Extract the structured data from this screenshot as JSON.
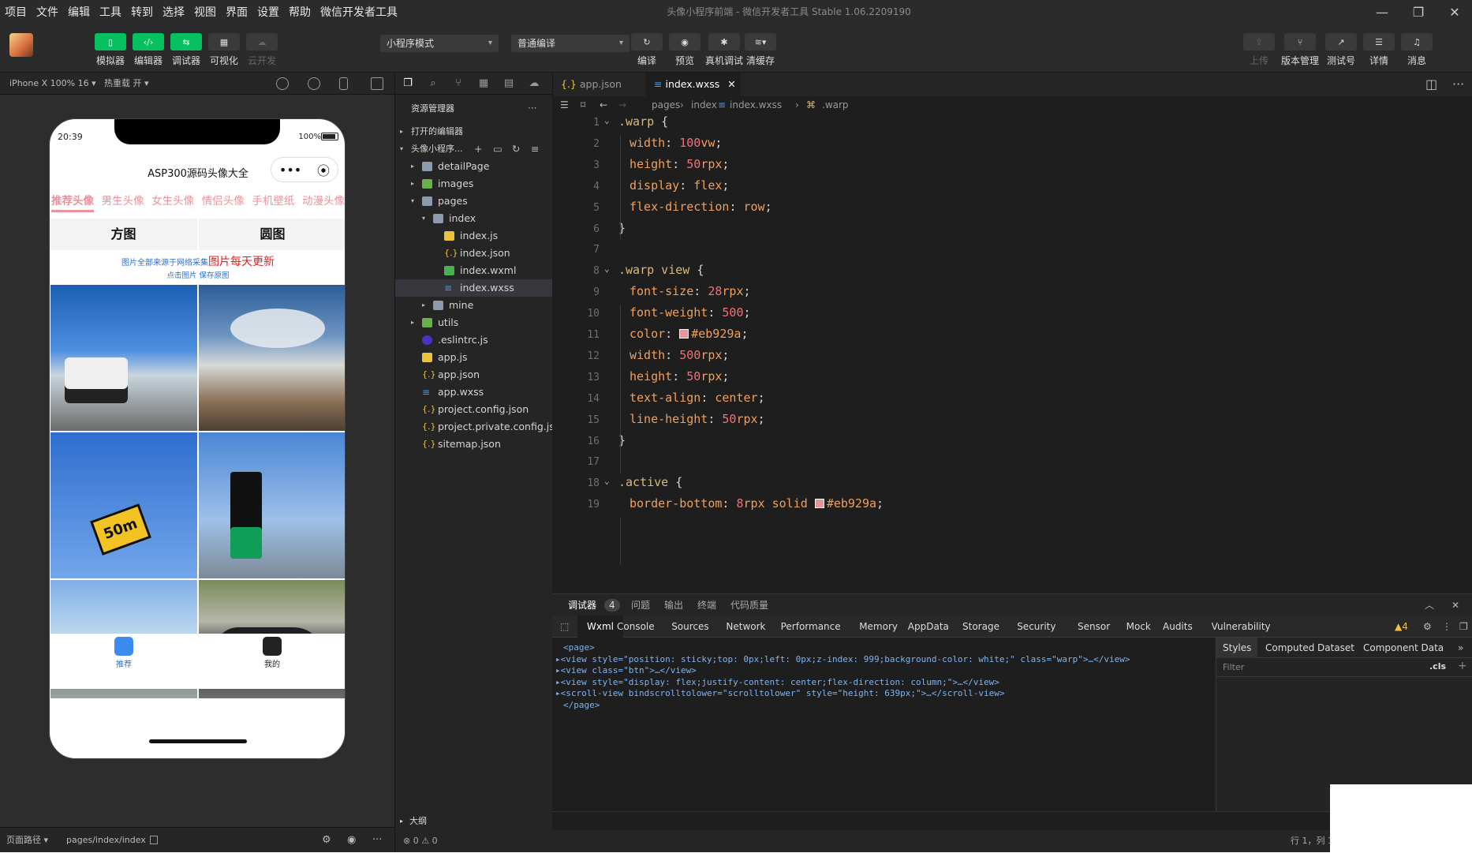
{
  "menu": [
    "项目",
    "文件",
    "编辑",
    "工具",
    "转到",
    "选择",
    "视图",
    "界面",
    "设置",
    "帮助",
    "微信开发者工具"
  ],
  "window_title": "头像小程序前端 - 微信开发者工具 Stable 1.06.2209190",
  "toolbar": {
    "left": [
      "模拟器",
      "编辑器",
      "调试器",
      "可视化",
      "云开发"
    ],
    "mode_select": "小程序模式",
    "compile_select": "普通编译",
    "mid": [
      "编译",
      "预览",
      "真机调试",
      "清缓存"
    ],
    "right": [
      "上传",
      "版本管理",
      "测试号",
      "详情",
      "消息"
    ]
  },
  "simbar": {
    "device": "iPhone X 100% 16 ▾",
    "hotreload": "热重载 开 ▾"
  },
  "phone": {
    "time": "20:39",
    "battery": "100%",
    "title": "ASP300源码头像大全",
    "capsule_dots": "•••",
    "capsule_circle": "⦿",
    "tabs": [
      "推荐头像",
      "男生头像",
      "女生头像",
      "情侣头像",
      "手机壁纸",
      "动漫头像"
    ],
    "seg": [
      "方图",
      "圆图"
    ],
    "note1": "图片全部来源于网络采集",
    "note1_red": "图片每天更新",
    "note2": "点击图片 保存原图",
    "bottom": [
      "推荐",
      "我的"
    ]
  },
  "simfoot": {
    "path_label": "页面路径 ▾",
    "path": "pages/index/index"
  },
  "explorer": {
    "title": "资源管理器",
    "open_editors": "打开的编辑器",
    "project": "头像小程序...",
    "items": [
      {
        "name": "detailPage",
        "type": "folder",
        "depth": 1,
        "arrow": "▸"
      },
      {
        "name": "images",
        "type": "folderg",
        "depth": 1,
        "arrow": "▸"
      },
      {
        "name": "pages",
        "type": "folder",
        "depth": 1,
        "arrow": "▾"
      },
      {
        "name": "index",
        "type": "folder",
        "depth": 2,
        "arrow": "▾"
      },
      {
        "name": "index.js",
        "type": "js",
        "depth": 3,
        "arrow": ""
      },
      {
        "name": "index.json",
        "type": "json",
        "depth": 3,
        "arrow": ""
      },
      {
        "name": "index.wxml",
        "type": "wxml",
        "depth": 3,
        "arrow": ""
      },
      {
        "name": "index.wxss",
        "type": "wxss",
        "depth": 3,
        "arrow": "",
        "selected": true
      },
      {
        "name": "mine",
        "type": "folder",
        "depth": 2,
        "arrow": "▸"
      },
      {
        "name": "utils",
        "type": "folderg",
        "depth": 1,
        "arrow": "▸"
      },
      {
        "name": ".eslintrc.js",
        "type": "eslint",
        "depth": 1,
        "arrow": ""
      },
      {
        "name": "app.js",
        "type": "js",
        "depth": 1,
        "arrow": ""
      },
      {
        "name": "app.json",
        "type": "json",
        "depth": 1,
        "arrow": ""
      },
      {
        "name": "app.wxss",
        "type": "wxss",
        "depth": 1,
        "arrow": ""
      },
      {
        "name": "project.config.json",
        "type": "json",
        "depth": 1,
        "arrow": ""
      },
      {
        "name": "project.private.config.js...",
        "type": "json",
        "depth": 1,
        "arrow": ""
      },
      {
        "name": "sitemap.json",
        "type": "json",
        "depth": 1,
        "arrow": ""
      }
    ],
    "outline": "大纲",
    "problems": "⊗ 0 ⚠ 0"
  },
  "editor": {
    "tabs": [
      {
        "name": "app.json",
        "active": false
      },
      {
        "name": "index.wxss",
        "active": true
      }
    ],
    "breadcrumb": [
      "pages",
      "index",
      "index.wxss",
      ".warp"
    ],
    "lines": [
      {
        "n": "1",
        "text": ".warp {",
        "kind": "sel"
      },
      {
        "n": "2",
        "text": "width: 100vw;",
        "kind": "prop"
      },
      {
        "n": "3",
        "text": "height: 50rpx;",
        "kind": "prop"
      },
      {
        "n": "4",
        "text": "display: flex;",
        "kind": "prop"
      },
      {
        "n": "5",
        "text": "flex-direction: row;",
        "kind": "prop"
      },
      {
        "n": "6",
        "text": "}",
        "kind": "close"
      },
      {
        "n": "7",
        "text": "",
        "kind": "blank"
      },
      {
        "n": "8",
        "text": ".warp view {",
        "kind": "sel"
      },
      {
        "n": "9",
        "text": "font-size: 28rpx;",
        "kind": "prop"
      },
      {
        "n": "10",
        "text": "font-weight: 500;",
        "kind": "prop"
      },
      {
        "n": "11",
        "text": "color: #eb929a;",
        "kind": "color"
      },
      {
        "n": "12",
        "text": "width: 500rpx;",
        "kind": "prop"
      },
      {
        "n": "13",
        "text": "height: 50rpx;",
        "kind": "prop"
      },
      {
        "n": "14",
        "text": "text-align: center;",
        "kind": "prop"
      },
      {
        "n": "15",
        "text": "line-height: 50rpx;",
        "kind": "prop"
      },
      {
        "n": "16",
        "text": "}",
        "kind": "close"
      },
      {
        "n": "17",
        "text": "",
        "kind": "blank"
      },
      {
        "n": "18",
        "text": ".active {",
        "kind": "sel"
      },
      {
        "n": "19",
        "text": "border-bottom: 8rpx solid #eb929a;",
        "kind": "color"
      }
    ]
  },
  "devtools": {
    "top": [
      "调试器",
      "4",
      "问题",
      "输出",
      "终端",
      "代码质量"
    ],
    "tabs": [
      "Wxml",
      "Console",
      "Sources",
      "Network",
      "Performance",
      "Memory",
      "AppData",
      "Storage",
      "Security",
      "Sensor",
      "Mock",
      "Audits",
      "Vulnerability"
    ],
    "warn": "▲4",
    "wxml_lines": [
      "<page>",
      "▸<view style=\"position: sticky;top: 0px;left: 0px;z-index: 999;background-color: white;\" class=\"warp\">…</view>",
      "▸<view class=\"btn\">…</view>",
      "▸<view style=\"display: flex;justify-content: center;flex-direction: column;\">…</view>",
      "▸<scroll-view bindscrolltolower=\"scrolltolower\" style=\"height: 639px;\">…</scroll-view>",
      "</page>"
    ],
    "style_tabs": [
      "Styles",
      "Computed",
      "Dataset",
      "Component Data"
    ],
    "filter": "Filter",
    "cls": ".cls",
    "plus": "+"
  },
  "status": {
    "pos": "行 1，列 1"
  },
  "colors": {
    "accent": "#eb929a",
    "green": "#07c160"
  }
}
